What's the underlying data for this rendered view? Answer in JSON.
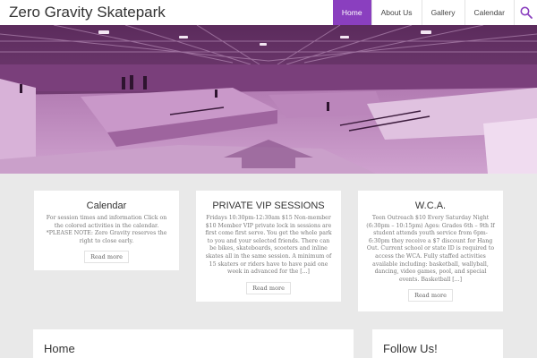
{
  "site": {
    "title": "Zero Gravity Skatepark"
  },
  "nav": {
    "items": [
      {
        "label": "Home",
        "active": true
      },
      {
        "label": "About Us",
        "active": false
      },
      {
        "label": "Gallery",
        "active": false
      },
      {
        "label": "Calendar",
        "active": false
      }
    ],
    "search_icon": "search-icon"
  },
  "hero": {
    "image": "skatepark-panorama-purple"
  },
  "cards": [
    {
      "title": "Calendar",
      "body": "For session times and information Click on the colored activities in the calendar. *PLEASE NOTE: Zero Gravity reserves the right to close early.",
      "read_more": "Read more"
    },
    {
      "title": "PRIVATE VIP SESSIONS",
      "body": "Fridays 10:30pm-12:30am $15 Non-member $10 Member VIP private lock in sessions are first come first serve. You get the whole park to you and your selected friends. There can be bikes, skateboards, scooters and inline skates all in the same session. A minimum of 15 skaters or riders have to have paid one week in advanced for the [...]",
      "read_more": "Read more"
    },
    {
      "title": "W.C.A.",
      "body": "Teen Outreach $10 Every Saturday Night (6:30pm – 10:15pm) Ages: Grades 6th – 9th If student attends youth service from 6pm-6:30pm they receive a $7 discount for Hang Out. Current school or state ID is required to access the WCA. Fully staffed activities available including: basketball, wallyball, dancing, video games, pool, and special events. Basketball [...]",
      "read_more": "Read more"
    }
  ],
  "main": {
    "heading": "Home"
  },
  "sidebar": {
    "heading": "Follow Us!"
  },
  "colors": {
    "accent": "#8a3fbf",
    "background": "#e9e9e9",
    "hero_tint": "#9b5c9b"
  }
}
